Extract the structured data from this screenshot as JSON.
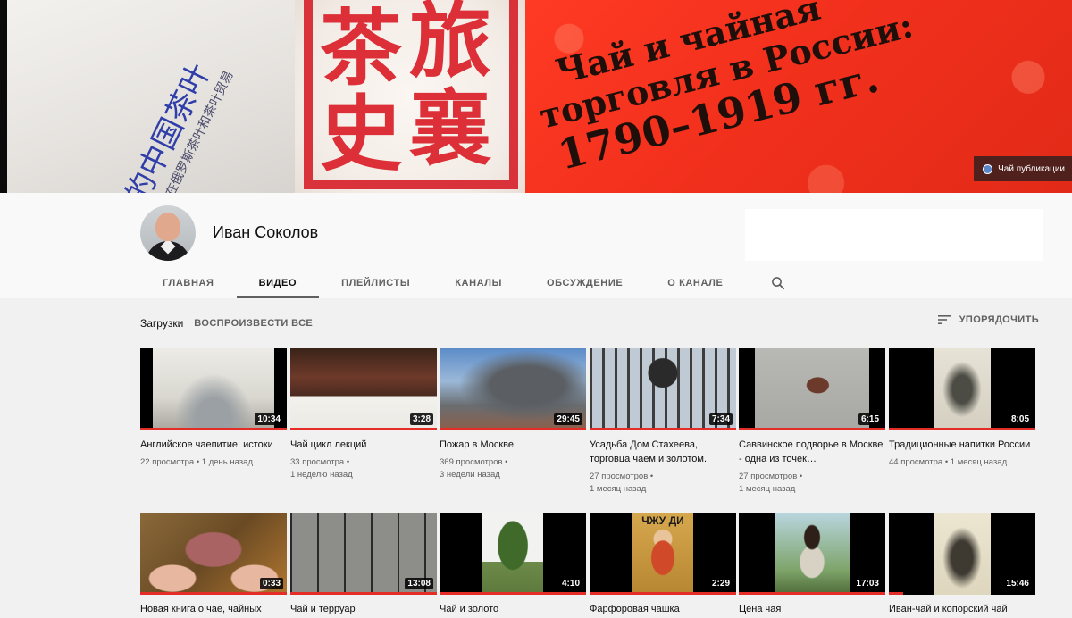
{
  "banner": {
    "card_lines": [
      "的中国茶叶",
      "在俄罗斯茶叶和茶叶贸易"
    ],
    "seal_chars": [
      "旅",
      "茶",
      "襄",
      "史"
    ],
    "book_title_lines": [
      "Чай и чайная",
      "торговля в России:",
      "1790–1919 гг."
    ],
    "link_label": "Чай публикации"
  },
  "channel": {
    "name": "Иван Соколов"
  },
  "tabs": [
    {
      "label": "ГЛАВНАЯ",
      "active": false
    },
    {
      "label": "ВИДЕО",
      "active": true
    },
    {
      "label": "ПЛЕЙЛИСТЫ",
      "active": false
    },
    {
      "label": "КАНАЛЫ",
      "active": false
    },
    {
      "label": "ОБСУЖДЕНИЕ",
      "active": false
    },
    {
      "label": "О КАНАЛЕ",
      "active": false
    }
  ],
  "section": {
    "title": "Загрузки",
    "play_all": "ВОСПРОИЗВЕСТИ ВСЕ",
    "sort_label": "УПОРЯДОЧИТЬ"
  },
  "videos": [
    {
      "title": "Английское чаепитие: истоки",
      "duration": "10:34",
      "meta_lines": [
        "22 просмотра • 1 день назад"
      ],
      "thumb": "sailing-ship",
      "watched": 1.0
    },
    {
      "title": "Чай цикл лекций",
      "duration": "3:28",
      "meta_lines": [
        "33 просмотра •",
        "1 неделю назад"
      ],
      "thumb": "lecture-slide",
      "watched": 1.0
    },
    {
      "title": "Пожар в Москве",
      "duration": "29:45",
      "meta_lines": [
        "369 просмотров •",
        "3 недели назад"
      ],
      "thumb": "fire-smoke",
      "watched": 1.0
    },
    {
      "title": "Усадьба Дом Стахеева, торговца чаем и золотом.",
      "duration": "7:34",
      "meta_lines": [
        "27 просмотров •",
        "1 месяц назад"
      ],
      "thumb": "iron-gate",
      "watched": 1.0
    },
    {
      "title": "Саввинское подворье в Москве - одна из точек…",
      "duration": "6:15",
      "meta_lines": [
        "27 просмотров •",
        "1 месяц назад"
      ],
      "thumb": "building-facade",
      "watched": 1.0
    },
    {
      "title": "Традиционные напитки России",
      "duration": "8:05",
      "meta_lines": [
        "44 просмотра • 1 месяц назад"
      ],
      "thumb": "botanical-print",
      "watched": 1.0
    },
    {
      "title": "Новая книга о чае, чайных",
      "duration": "0:33",
      "meta_lines": [],
      "thumb": "book-hands",
      "watched": 1.0
    },
    {
      "title": "Чай и терруар",
      "duration": "13:08",
      "meta_lines": [],
      "thumb": "old-office",
      "watched": 1.0
    },
    {
      "title": "Чай и золото",
      "duration": "4:10",
      "meta_lines": [],
      "thumb": "tree",
      "watched": 1.0
    },
    {
      "title": "Фарфоровая чашка",
      "duration": "2:29",
      "meta_lines": [],
      "thumb": "emperor-portrait",
      "thumb_caption": "ЧЖУ ДИ",
      "watched": 1.0
    },
    {
      "title": "Цена чая",
      "duration": "17:03",
      "meta_lines": [],
      "thumb": "tea-picker",
      "watched": 1.0
    },
    {
      "title": "Иван-чай и копорский чай",
      "duration": "15:46",
      "meta_lines": [],
      "thumb": "botanical-print-2",
      "watched": 0.1
    }
  ]
}
